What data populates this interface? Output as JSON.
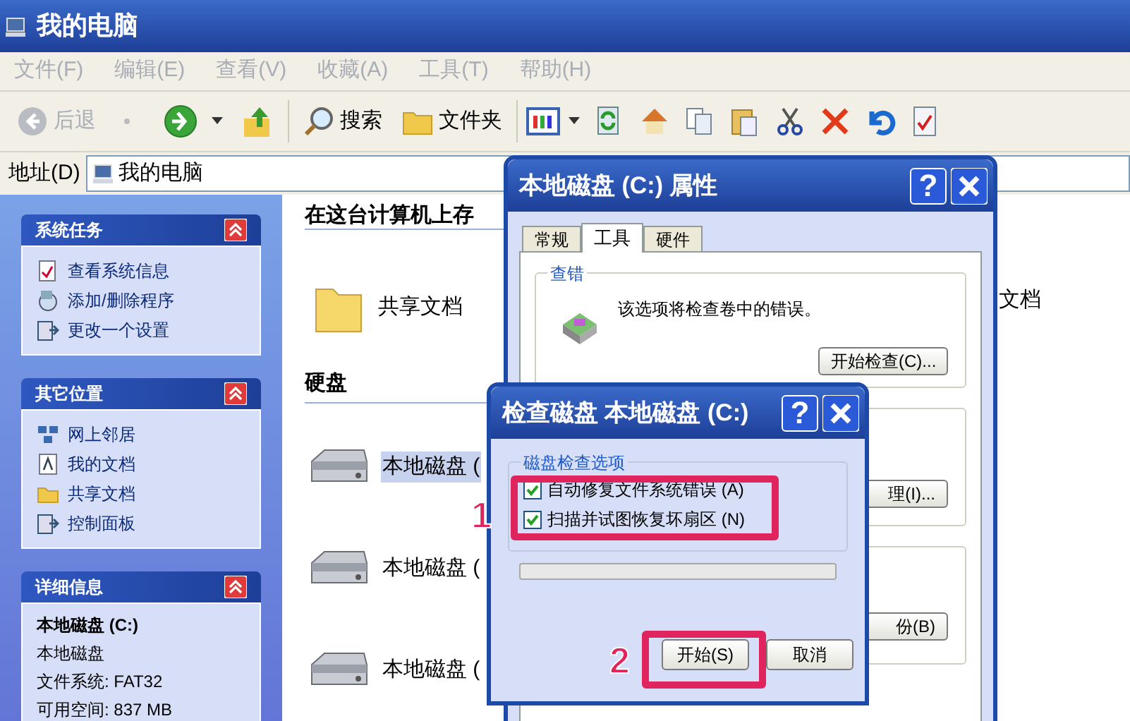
{
  "window": {
    "title": "我的电脑"
  },
  "menu": [
    {
      "label": "文件(F)"
    },
    {
      "label": "编辑(E)"
    },
    {
      "label": "查看(V)"
    },
    {
      "label": "收藏(A)"
    },
    {
      "label": "工具(T)"
    },
    {
      "label": "帮助(H)"
    }
  ],
  "toolbar": {
    "back": {
      "label": "后退",
      "disabled": true
    },
    "search": {
      "label": "搜索"
    },
    "folders": {
      "label": "文件夹"
    }
  },
  "address": {
    "label": "地址(D)",
    "value": "我的电脑"
  },
  "task_panels": [
    {
      "title": "系统任务",
      "items": [
        {
          "label": "查看系统信息",
          "kind": "info"
        },
        {
          "label": "添加/删除程序",
          "kind": "programs"
        },
        {
          "label": "更改一个设置",
          "kind": "settings"
        }
      ]
    },
    {
      "title": "其它位置",
      "items": [
        {
          "label": "网上邻居",
          "kind": "network"
        },
        {
          "label": "我的文档",
          "kind": "documents"
        },
        {
          "label": "共享文档",
          "kind": "folder"
        },
        {
          "label": "控制面板",
          "kind": "settings"
        }
      ]
    }
  ],
  "details": {
    "title": "详细信息",
    "name": "本地磁盘 (C:)",
    "type": "本地磁盘",
    "lines": [
      "文件系统: FAT32",
      "可用空间: 837 MB"
    ]
  },
  "content": {
    "files_heading": "在这台计算机上存",
    "files": [
      {
        "label": "共享文档"
      }
    ],
    "partial_item": "文档",
    "disks_heading": "硬盘",
    "drives": [
      {
        "label": "本地磁盘 (",
        "selected": true
      },
      {
        "label": "本地磁盘 (",
        "selected": false
      },
      {
        "label": "本地磁盘 (",
        "selected": false
      }
    ]
  },
  "properties_dialog": {
    "title": "本地磁盘 (C:) 属性",
    "help": "?",
    "tabs": [
      {
        "label": "常规",
        "selected": false
      },
      {
        "label": "工具",
        "selected": true
      },
      {
        "label": "硬件",
        "selected": false
      }
    ],
    "error_group": {
      "title": "查错",
      "text": "该选项将检查卷中的错误。",
      "button": "开始检查(C)..."
    },
    "button_2": "理(I)...",
    "button_3": "份(B)"
  },
  "check_dialog": {
    "title": "检查磁盘 本地磁盘 (C:)",
    "help": "?",
    "group_title": "磁盘检查选项",
    "options": [
      {
        "label": "自动修复文件系统错误 (A)",
        "checked": true
      },
      {
        "label": "扫描并试图恢复坏扇区 (N)",
        "checked": true
      }
    ],
    "progress": {
      "level": 0
    },
    "buttons": [
      "开始(S)",
      "取消"
    ]
  },
  "annotations": [
    {
      "number": "1"
    },
    {
      "number": "2"
    }
  ]
}
